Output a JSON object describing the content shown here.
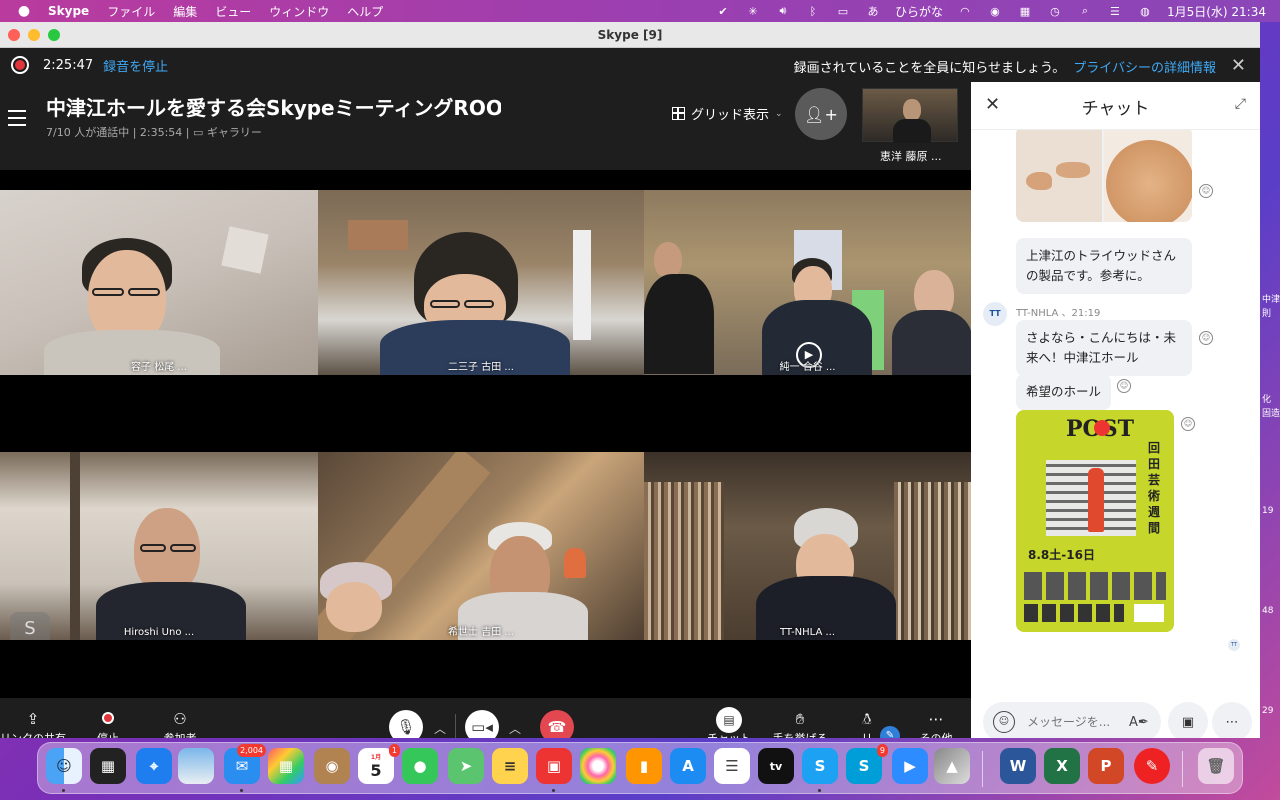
{
  "menubar": {
    "app": "Skype",
    "items": [
      "ファイル",
      "編集",
      "ビュー",
      "ウィンドウ",
      "ヘルプ"
    ],
    "input_method_short": "あ",
    "input_method": "ひらがな",
    "clock": "1月5日(水)  21:34"
  },
  "window": {
    "title": "Skype [9]"
  },
  "recording": {
    "elapsed": "2:25:47",
    "stop_label": "録音を停止",
    "notice": "録画されていることを全員に知らせましょう。",
    "privacy_link": "プライバシーの詳細情報"
  },
  "call": {
    "title": "中津江ホールを愛する会SkypeミーティングROOM",
    "participants": "7/10 人が通話中 | 2:35:54 |",
    "view_mode": "ギャラリー",
    "grid_label": "グリッド表示",
    "self_name": "恵洋 藤原 ..."
  },
  "tiles": [
    {
      "name": "容子 松尾 ..."
    },
    {
      "name": "二三子 古田 ..."
    },
    {
      "name": "純一 合谷 ..."
    },
    {
      "name": "Hiroshi Uno ..."
    },
    {
      "name": "希世士 吉田 ..."
    },
    {
      "name": "TT-NHLA ..."
    }
  ],
  "toolbar": {
    "share_link": "リンクの共有",
    "stop": "停止",
    "participants": "参加者",
    "chat": "チャット",
    "raise_hand": "手を挙げる",
    "react": "リ",
    "more": "その他"
  },
  "chat": {
    "title": "チャット",
    "msg1": "上津江のトライウッドさんの製品です。参考に。",
    "sender_initials": "TT",
    "sender_line": "TT-NHLA 、21:19",
    "msg2": "さよなら・こんにちは・未来へ！中津江ホール",
    "msg3": "希望のホール",
    "poster_title": "POST",
    "poster_vertical": "回田芸術週間",
    "poster_dates": "8.8土-16日",
    "input_placeholder": "メッセージを..."
  },
  "desktop_fragments": [
    "中津",
    "則",
    "化",
    "固造",
    "19",
    "48",
    "29"
  ],
  "dock": {
    "mail_badge": "2,004",
    "calendar_month": "1月",
    "calendar_day": "5",
    "calendar_badge": "1",
    "skype_badge": "9",
    "tv_label": "tv"
  },
  "colors": {
    "accent": "#3fa9f5",
    "record_red": "#e0353a",
    "hangup_red": "#e3474f",
    "poster_yellow": "#c6d62a"
  }
}
